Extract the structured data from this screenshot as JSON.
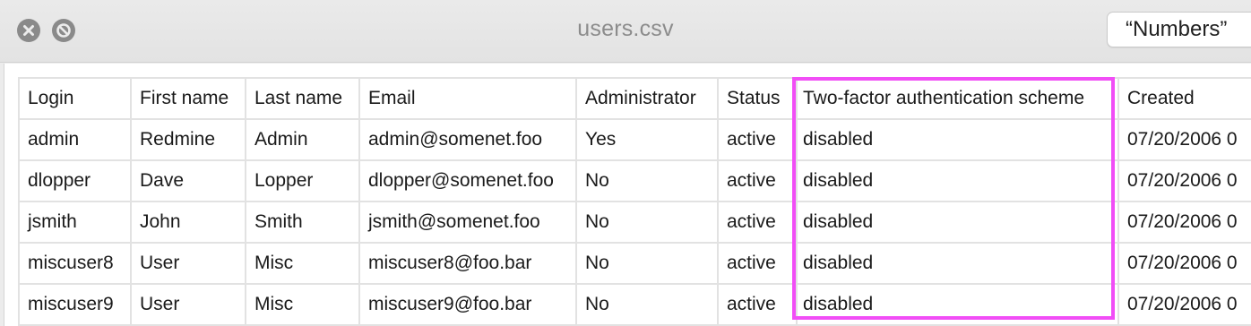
{
  "window": {
    "title": "users.csv",
    "open_with_label": "“Numbers”"
  },
  "icons": {
    "close": "close-icon",
    "quicklook": "quicklook-icon"
  },
  "table": {
    "headers": [
      "Login",
      "First name",
      "Last name",
      "Email",
      "Administrator",
      "Status",
      "Two-factor authentication scheme",
      "Created"
    ],
    "rows": [
      [
        "admin",
        "Redmine",
        "Admin",
        "admin@somenet.foo",
        "Yes",
        "active",
        "disabled",
        "07/20/2006 0"
      ],
      [
        "dlopper",
        "Dave",
        "Lopper",
        "dlopper@somenet.foo",
        "No",
        "active",
        "disabled",
        "07/20/2006 0"
      ],
      [
        "jsmith",
        "John",
        "Smith",
        "jsmith@somenet.foo",
        "No",
        "active",
        "disabled",
        "07/20/2006 0"
      ],
      [
        "miscuser8",
        "User",
        "Misc",
        "miscuser8@foo.bar",
        "No",
        "active",
        "disabled",
        "07/20/2006 0"
      ],
      [
        "miscuser9",
        "User",
        "Misc",
        "miscuser9@foo.bar",
        "No",
        "active",
        "disabled",
        "07/20/2006 0"
      ]
    ]
  },
  "highlight": {
    "column": "Two-factor authentication scheme",
    "color": "#f14ef6"
  }
}
